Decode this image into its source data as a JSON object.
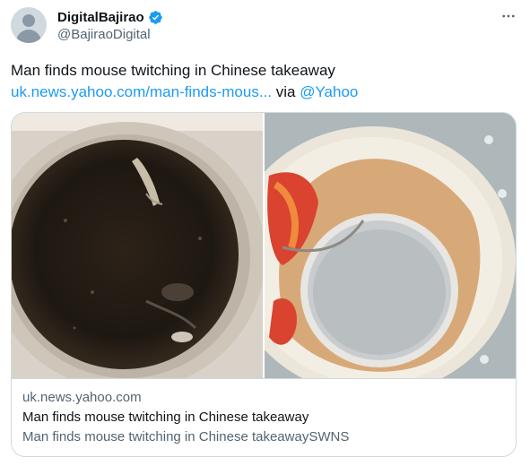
{
  "author": {
    "display_name": "DigitalBajirao",
    "handle": "@BajiraoDigital",
    "verified": true
  },
  "tweet": {
    "text": "Man finds mouse twitching in Chinese takeaway",
    "link_text": "uk.news.yahoo.com/man-finds-mous...",
    "via_text": " via ",
    "mention": "@Yahoo"
  },
  "card": {
    "domain": "uk.news.yahoo.com",
    "title": "Man finds mouse twitching in Chinese takeaway",
    "description": "Man finds mouse twitching in Chinese takeawaySWNS"
  },
  "icons": {
    "verified": "verified-badge-icon",
    "more": "more-options-icon"
  },
  "colors": {
    "link": "#1d9bf0",
    "text": "#0f1419",
    "secondary": "#536471",
    "border": "#cfd9de"
  }
}
